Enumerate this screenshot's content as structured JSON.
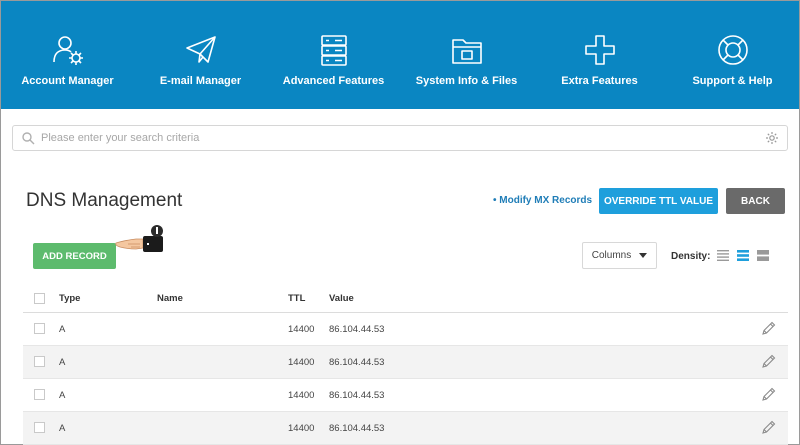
{
  "nav": [
    {
      "label": "Account Manager",
      "icon": "account-manager-icon"
    },
    {
      "label": "E-mail Manager",
      "icon": "paper-plane-icon"
    },
    {
      "label": "Advanced Features",
      "icon": "server-icon"
    },
    {
      "label": "System Info & Files",
      "icon": "folder-icon"
    },
    {
      "label": "Extra Features",
      "icon": "plus-icon"
    },
    {
      "label": "Support & Help",
      "icon": "lifebuoy-icon"
    }
  ],
  "search": {
    "placeholder": "Please enter your search criteria"
  },
  "page": {
    "title": "DNS Management",
    "mx_link": "• Modify MX Records",
    "override_button": "OVERRIDE TTL VALUE",
    "back_button": "BACK",
    "add_button": "ADD RECORD",
    "columns_button": "Columns",
    "density_label": "Density:"
  },
  "table": {
    "headers": {
      "type": "Type",
      "name": "Name",
      "ttl": "TTL",
      "value": "Value"
    },
    "rows": [
      {
        "type": "A",
        "name": "",
        "ttl": "14400",
        "value": "86.104.44.53"
      },
      {
        "type": "A",
        "name": "",
        "ttl": "14400",
        "value": "86.104.44.53"
      },
      {
        "type": "A",
        "name": "",
        "ttl": "14400",
        "value": "86.104.44.53"
      },
      {
        "type": "A",
        "name": "",
        "ttl": "14400",
        "value": "86.104.44.53"
      }
    ]
  },
  "colors": {
    "nav_bg": "#0a86c2",
    "accent": "#1e9fdc",
    "add_green": "#5dbb6d",
    "back_gray": "#6a6a6a"
  }
}
